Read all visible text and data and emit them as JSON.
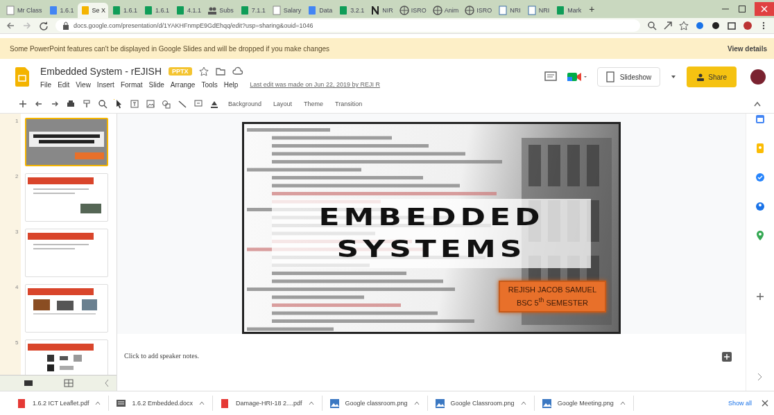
{
  "browser": {
    "tabs": [
      {
        "label": "Mr Class",
        "selected": false
      },
      {
        "label": "1.6.1",
        "selected": false
      },
      {
        "label": "Se X",
        "selected": true
      },
      {
        "label": "1.6.1",
        "selected": false
      },
      {
        "label": "1.6.1",
        "selected": false
      },
      {
        "label": "4.1.1",
        "selected": false
      },
      {
        "label": "Subs",
        "selected": false
      },
      {
        "label": "7.1.1",
        "selected": false
      },
      {
        "label": "Salary",
        "selected": false
      },
      {
        "label": "Data",
        "selected": false
      },
      {
        "label": "3.2.1",
        "selected": false
      },
      {
        "label": "NIR",
        "selected": false
      },
      {
        "label": "ISRO",
        "selected": false
      },
      {
        "label": "Anim",
        "selected": false
      },
      {
        "label": "ISRO",
        "selected": false
      },
      {
        "label": "NRI",
        "selected": false
      },
      {
        "label": "NRI",
        "selected": false
      },
      {
        "label": "Mark",
        "selected": false
      }
    ],
    "new_tab": "+",
    "url": "docs.google.com/presentation/d/1YAKHFnmpE9GdEhqq/edit?usp=sharing&ouid=1046"
  },
  "notice": {
    "message": "Some PowerPoint features can't be displayed in Google Slides and will be dropped if you make changes",
    "action": "View details"
  },
  "document": {
    "title": "Embedded System - rEJISH",
    "badge": "PPTX",
    "menu": [
      "File",
      "Edit",
      "View",
      "Insert",
      "Format",
      "Slide",
      "Arrange",
      "Tools",
      "Help"
    ],
    "last_edit": "Last edit was made on Jun 22, 2019 by REJI R",
    "slideshow": "Slideshow",
    "share": "Share"
  },
  "toolbar": {
    "buttons": [
      "Background",
      "Layout",
      "Theme",
      "Transition"
    ]
  },
  "filmstrip": [
    {
      "number": "1",
      "kind": "title",
      "selected": true
    },
    {
      "number": "2",
      "kind": "content",
      "selected": false
    },
    {
      "number": "3",
      "kind": "content",
      "selected": false
    },
    {
      "number": "4",
      "kind": "images",
      "selected": false
    },
    {
      "number": "5",
      "kind": "grid",
      "selected": false
    }
  ],
  "slide": {
    "title_lines": [
      "EMBEDDED",
      "SYSTEMS"
    ],
    "subtitle_lines": [
      "REJISH JACOB SAMUEL",
      "BSC 5$^{th}$ SEMESTER"
    ]
  },
  "speaker_notes": {
    "placeholder": "Click to add speaker notes."
  },
  "downloads": {
    "items": [
      {
        "name": "1.6.2 ICT Leaflet.pdf"
      },
      {
        "name": "1.6.2 Embedded.docx"
      },
      {
        "name": "Damage-HRI-18 2....pdf"
      },
      {
        "name": "Google classroom.png"
      },
      {
        "name": "Google Classroom.png"
      },
      {
        "name": "Google Meeting.png"
      }
    ],
    "show_all": "Show all"
  }
}
